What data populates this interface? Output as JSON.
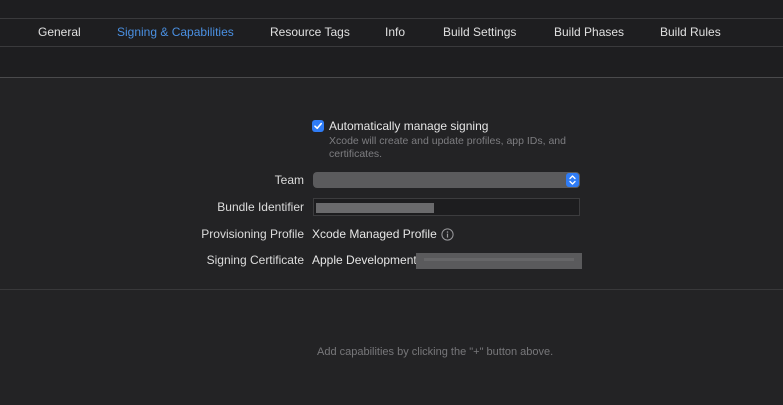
{
  "tabs": [
    {
      "label": "General",
      "active": false
    },
    {
      "label": "Signing & Capabilities",
      "active": true
    },
    {
      "label": "Resource Tags",
      "active": false
    },
    {
      "label": "Info",
      "active": false
    },
    {
      "label": "Build Settings",
      "active": false
    },
    {
      "label": "Build Phases",
      "active": false
    },
    {
      "label": "Build Rules",
      "active": false
    }
  ],
  "signing": {
    "auto_manage": {
      "checked": true,
      "label": "Automatically manage signing",
      "help": "Xcode will create and update profiles, app IDs, and certificates."
    },
    "team": {
      "label": "Team",
      "value": ""
    },
    "bundle_identifier": {
      "label": "Bundle Identifier",
      "value": ""
    },
    "provisioning_profile": {
      "label": "Provisioning Profile",
      "value": "Xcode Managed Profile"
    },
    "signing_certificate": {
      "label": "Signing Certificate",
      "value": "Apple Development:"
    }
  },
  "capabilities": {
    "empty_hint": "Add capabilities by clicking the \"+\" button above."
  },
  "colors": {
    "accent": "#2f7cf6",
    "active_tab": "#4a90e2",
    "background": "#1e1e20"
  },
  "icons": {
    "checkbox": "checkmark-icon",
    "popup": "up-down-chevron-icon",
    "info": "info-circle-icon"
  }
}
